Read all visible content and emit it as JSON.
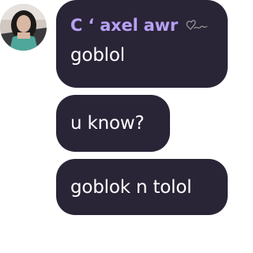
{
  "messages": [
    {
      "sender": "C ʻ axel awr",
      "text": "goblol"
    },
    {
      "text": "u know?"
    },
    {
      "text": "goblok n tolol"
    }
  ],
  "icons": {
    "avatar": "avatar-photo",
    "sender_decoration": "heart-scribble-icon"
  },
  "colors": {
    "bubble": "#2a2437",
    "sender_name": "#b6a0f2",
    "text": "#ffffff",
    "background": "#ffffff"
  }
}
